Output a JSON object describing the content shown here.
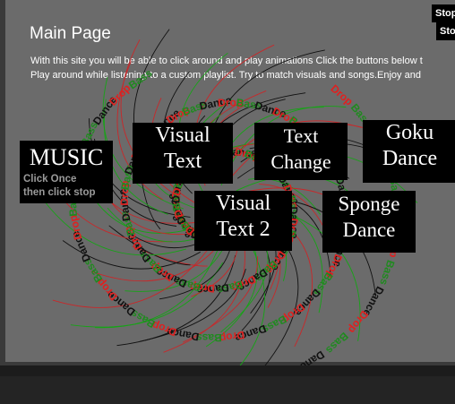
{
  "page": {
    "title": "Main Page",
    "intro_line_1": "With this site you will be able to click around and play animations Click the buttons below t",
    "intro_line_2": "Play around while listening to a custom playlist. Try to match visuals and songs.Enjoy and"
  },
  "buttons": {
    "music": "MUSIC",
    "music_hint_1": "Click Once",
    "music_hint_2": "then click stop",
    "visual_text_1": "Visual",
    "visual_text_2": "Text",
    "text_change_1": "Text",
    "text_change_2": "Change",
    "goku_1": "Goku",
    "goku_2": "Dance",
    "visual_text2_1": "Visual",
    "visual_text2_2": "Text 2",
    "sponge_1": "Sponge",
    "sponge_2": "Dance"
  },
  "controls": {
    "stop_1": "Stop...",
    "stop_2": "Sto"
  },
  "animation": {
    "words": [
      "Drop",
      "Bass",
      "Dance"
    ],
    "colors": {
      "Drop": "#e0201f",
      "Bass": "#1f8a1f",
      "Dance": "#111111",
      "strand_green": "#17a317",
      "strand_red": "#c8282a",
      "strand_dark": "#111111"
    }
  }
}
